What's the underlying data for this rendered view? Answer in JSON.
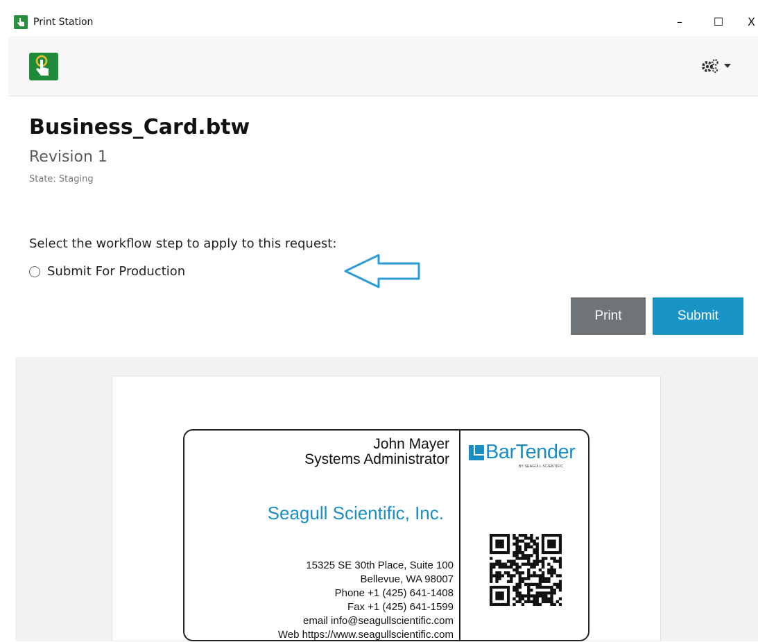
{
  "window": {
    "title": "Print Station",
    "controls": {
      "minimize": "–",
      "maximize": "☐",
      "close": "X"
    }
  },
  "header": {
    "settings_icon": "gears-icon"
  },
  "document": {
    "title": "Business_Card.btw",
    "revision": "Revision 1",
    "state": "State: Staging"
  },
  "workflow": {
    "prompt": "Select the workflow step to apply to this request:",
    "options": [
      {
        "label": "Submit For Production",
        "selected": false
      }
    ]
  },
  "actions": {
    "print_label": "Print",
    "submit_label": "Submit"
  },
  "colors": {
    "accent": "#1a93c7",
    "print_button": "#6f7479",
    "brand_green": "#1e8a3a",
    "company_blue": "#1a8ec3"
  },
  "preview": {
    "card": {
      "name": "John Mayer",
      "role": "Systems Administrator",
      "company": "Seagull Scientific, Inc.",
      "address_lines": [
        "15325 SE 30th Place, Suite 100",
        "Bellevue, WA 98007",
        "Phone +1 (425) 641-1408",
        "Fax +1 (425) 641-1599",
        "email info@seagullscientific.com",
        "Web https://www.seagullscientific.com"
      ],
      "logo_text": "BarTender",
      "logo_subtext": "BY SEAGULL SCIENTIFIC"
    }
  }
}
